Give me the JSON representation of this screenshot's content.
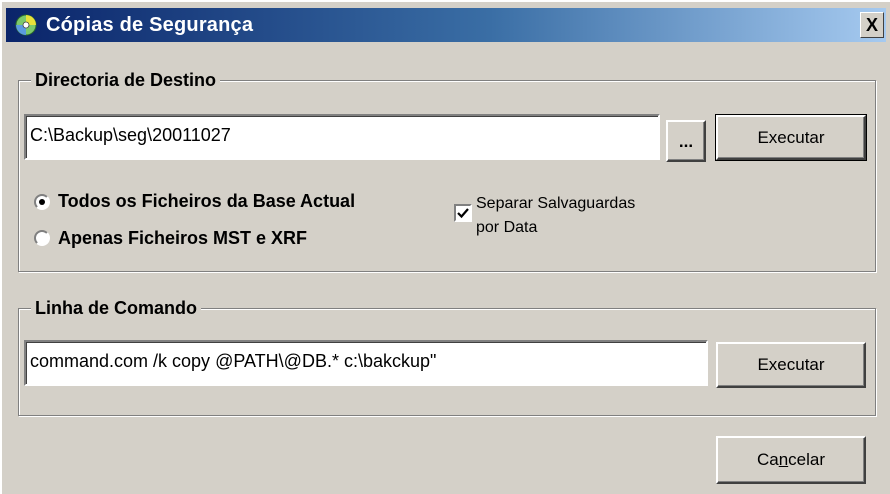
{
  "window": {
    "title": "Cópias de Segurança",
    "close_label": "X",
    "title_gradient": [
      "#0a246a",
      "#a6caf0"
    ]
  },
  "destination": {
    "legend": "Directoria de Destino",
    "path_value": "C:\\Backup\\seg\\20011027",
    "browse_label": "...",
    "execute_label": "Executar",
    "options": [
      {
        "label": "Todos os Ficheiros da Base Actual",
        "selected": true
      },
      {
        "label": "Apenas Ficheiros MST e XRF",
        "selected": false
      }
    ],
    "separate_by_date": {
      "line1": "Separar Salvaguardas",
      "line2": "por Data",
      "checked": true
    }
  },
  "command": {
    "legend": "Linha de Comando",
    "value": "command.com /k copy @PATH\\@DB.* c:\\bakckup\"",
    "execute_label": "Executar"
  },
  "footer": {
    "cancel_pre": "Ca",
    "cancel_accel": "n",
    "cancel_post": "celar"
  }
}
